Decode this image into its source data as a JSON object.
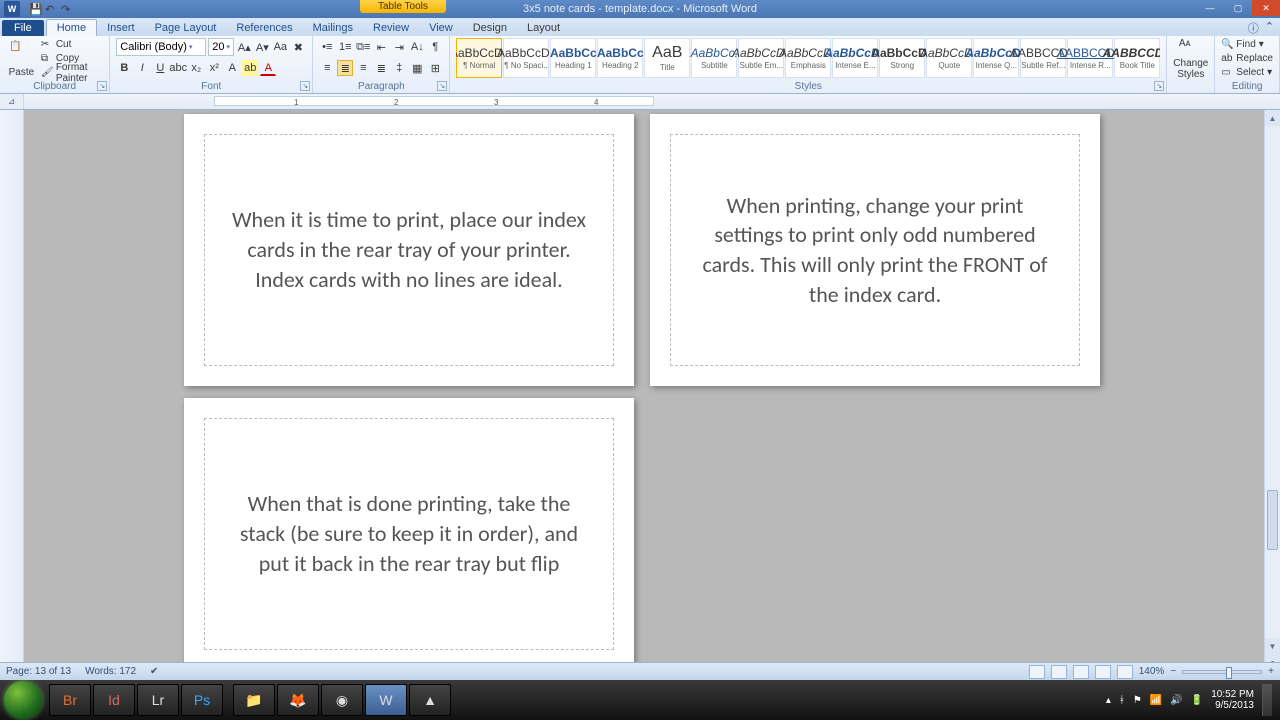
{
  "title": {
    "tooltab": "Table Tools",
    "doc": "3x5 note cards - template.docx - Microsoft Word"
  },
  "tabs": {
    "file": "File",
    "items": [
      "Home",
      "Insert",
      "Page Layout",
      "References",
      "Mailings",
      "Review",
      "View"
    ],
    "ctx": [
      "Design",
      "Layout"
    ]
  },
  "clipboard": {
    "paste": "Paste",
    "cut": "Cut",
    "copy": "Copy",
    "fpainter": "Format Painter",
    "label": "Clipboard"
  },
  "font": {
    "name": "Calibri (Body)",
    "size": "20",
    "label": "Font"
  },
  "para": {
    "label": "Paragraph"
  },
  "styles": {
    "label": "Styles",
    "items": [
      {
        "samp": "AaBbCcDc",
        "name": "¶ Normal",
        "cls": "sel"
      },
      {
        "samp": "AaBbCcDc",
        "name": "¶ No Spaci..."
      },
      {
        "samp": "AaBbCc",
        "name": "Heading 1",
        "cls": "blue bold"
      },
      {
        "samp": "AaBbCc",
        "name": "Heading 2",
        "cls": "blue bold"
      },
      {
        "samp": "AaB",
        "name": "Title",
        "cls": "big"
      },
      {
        "samp": "AaBbCc.",
        "name": "Subtitle",
        "cls": "blue ital"
      },
      {
        "samp": "AaBbCcDc",
        "name": "Subtle Em...",
        "cls": "ital"
      },
      {
        "samp": "AaBbCcDc",
        "name": "Emphasis",
        "cls": "ital"
      },
      {
        "samp": "AaBbCcDc",
        "name": "Intense E...",
        "cls": "blue bold ital"
      },
      {
        "samp": "AaBbCcDc",
        "name": "Strong",
        "cls": "bold"
      },
      {
        "samp": "AaBbCcDc",
        "name": "Quote",
        "cls": "ital"
      },
      {
        "samp": "AaBbCcDc",
        "name": "Intense Q...",
        "cls": "blue bold ital"
      },
      {
        "samp": "AABBCCDC",
        "name": "Subtle Ref..."
      },
      {
        "samp": "AABBCCDC",
        "name": "Intense R...",
        "cls": "blue under"
      },
      {
        "samp": "AABBCCDC",
        "name": "Book Title",
        "cls": "bold ital"
      }
    ],
    "change": "Change\nStyles"
  },
  "editing": {
    "find": "Find",
    "replace": "Replace",
    "select": "Select",
    "label": "Editing"
  },
  "ruler": {
    "marks": [
      "1",
      "2",
      "3",
      "4"
    ]
  },
  "cards": [
    "When it is time to print, place our index cards in the rear tray of your printer.  Index cards with no lines are ideal.",
    "When printing, change your print settings to print only odd numbered cards.  This will only print the FRONT of the index card.",
    "When that is done printing, take the stack (be sure to keep it in order), and put it back in the rear tray but flip"
  ],
  "status": {
    "page": "Page: 13 of 13",
    "words": "Words: 172",
    "zoom": "140%"
  },
  "tray": {
    "time": "10:52 PM",
    "date": "9/5/2013"
  }
}
